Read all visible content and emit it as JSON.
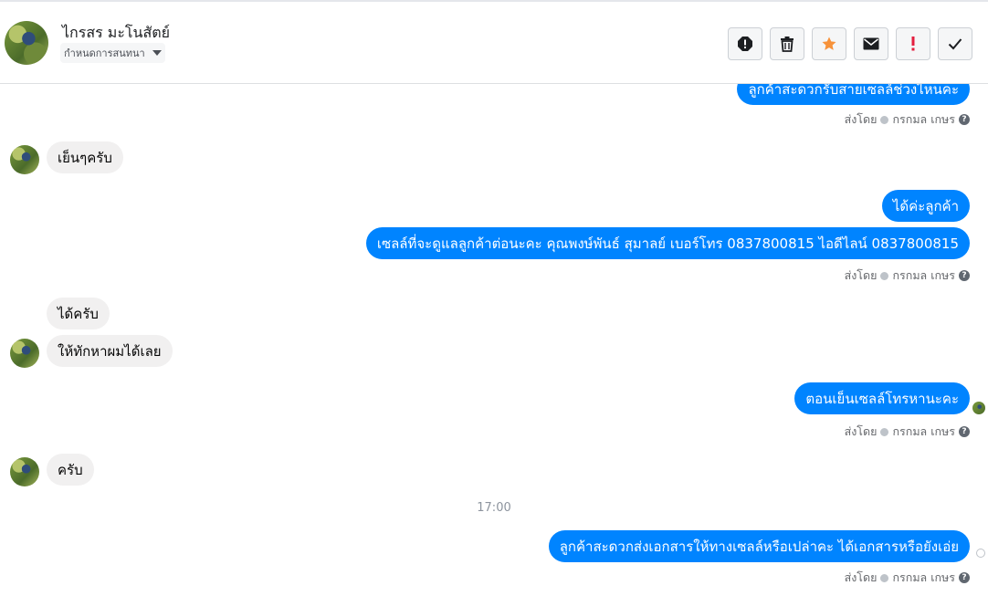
{
  "header": {
    "contact_name": "ไกรสร มะโนสัตย์",
    "conversation_settings": "กำหนดการสนทนา"
  },
  "actions": [
    {
      "name": "spam",
      "icon": "alert-circle-icon"
    },
    {
      "name": "delete",
      "icon": "trash-icon"
    },
    {
      "name": "star",
      "icon": "star-icon"
    },
    {
      "name": "mark-unread",
      "icon": "envelope-icon"
    },
    {
      "name": "flag-important",
      "icon": "exclamation-icon"
    },
    {
      "name": "mark-done",
      "icon": "check-icon"
    }
  ],
  "colors": {
    "outgoing_bubble": "#0084ff",
    "incoming_bubble": "#f1f0f0",
    "star": "#f7923a",
    "important": "#e41e3f"
  },
  "messages": [
    {
      "dir": "out",
      "text": "ลูกค้าสะดวกรับสายเซลล์ช่วงไหนคะ"
    },
    {
      "dir": "in",
      "text": "เย็นๆครับ"
    },
    {
      "dir": "out",
      "text": "ได้ค่ะลูกค้า"
    },
    {
      "dir": "out",
      "text": "เซลล์ที่จะดูแลลูกค้าต่อนะคะ  คุณพงษ์พันธ์ สุมาลย์      เบอร์โทร 0837800815  ไอดีไลน์ 0837800815"
    },
    {
      "dir": "in",
      "text": "ได้ครับ"
    },
    {
      "dir": "in",
      "text": "ให้ทักหาผมได้เลย"
    },
    {
      "dir": "out",
      "text": "ตอนเย็นเซลล์โทรหานะคะ"
    },
    {
      "dir": "in",
      "text": "ครับ"
    },
    {
      "dir": "out",
      "text": "ลูกค้าสะดวกส่งเอกสารให้ทางเซลล์หรือเปล่าคะ ได้เอกสารหรือยังเอ่ย"
    }
  ],
  "sent_by": {
    "label": "ส่งโดย",
    "agent": "กรกมล เกษร",
    "help": "?"
  },
  "time_divider": "17:00"
}
